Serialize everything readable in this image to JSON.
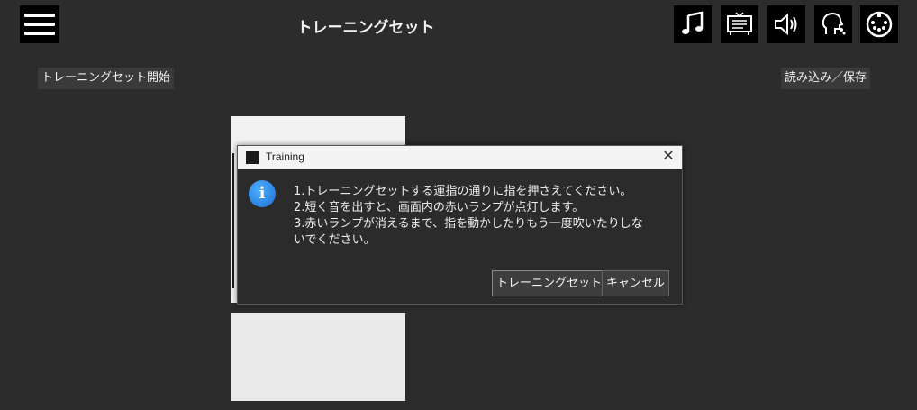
{
  "header": {
    "title": "トレーニングセット",
    "icons": [
      "music-note-icon",
      "display-icon",
      "speaker-icon",
      "breath-icon",
      "midi-icon"
    ]
  },
  "actions": {
    "start_training": "トレーニングセット開始",
    "load_save": "読み込み／保存"
  },
  "dialog": {
    "title": "Training",
    "close_glyph": "✕",
    "info_glyph": "i",
    "message_lines": [
      "1.トレーニングセットする運指の通りに指を押さえてください。",
      "2.短く音を出すと、画面内の赤いランプが点灯します。",
      "3.赤いランプが消えるまで、指を動かしたりもう一度吹いたりしな",
      "いでください。"
    ],
    "confirm_label": "トレーニングセット",
    "cancel_label": "キャンセル"
  },
  "colors": {
    "background": "#2c2c2c",
    "info_accent": "#1a6fd1"
  }
}
